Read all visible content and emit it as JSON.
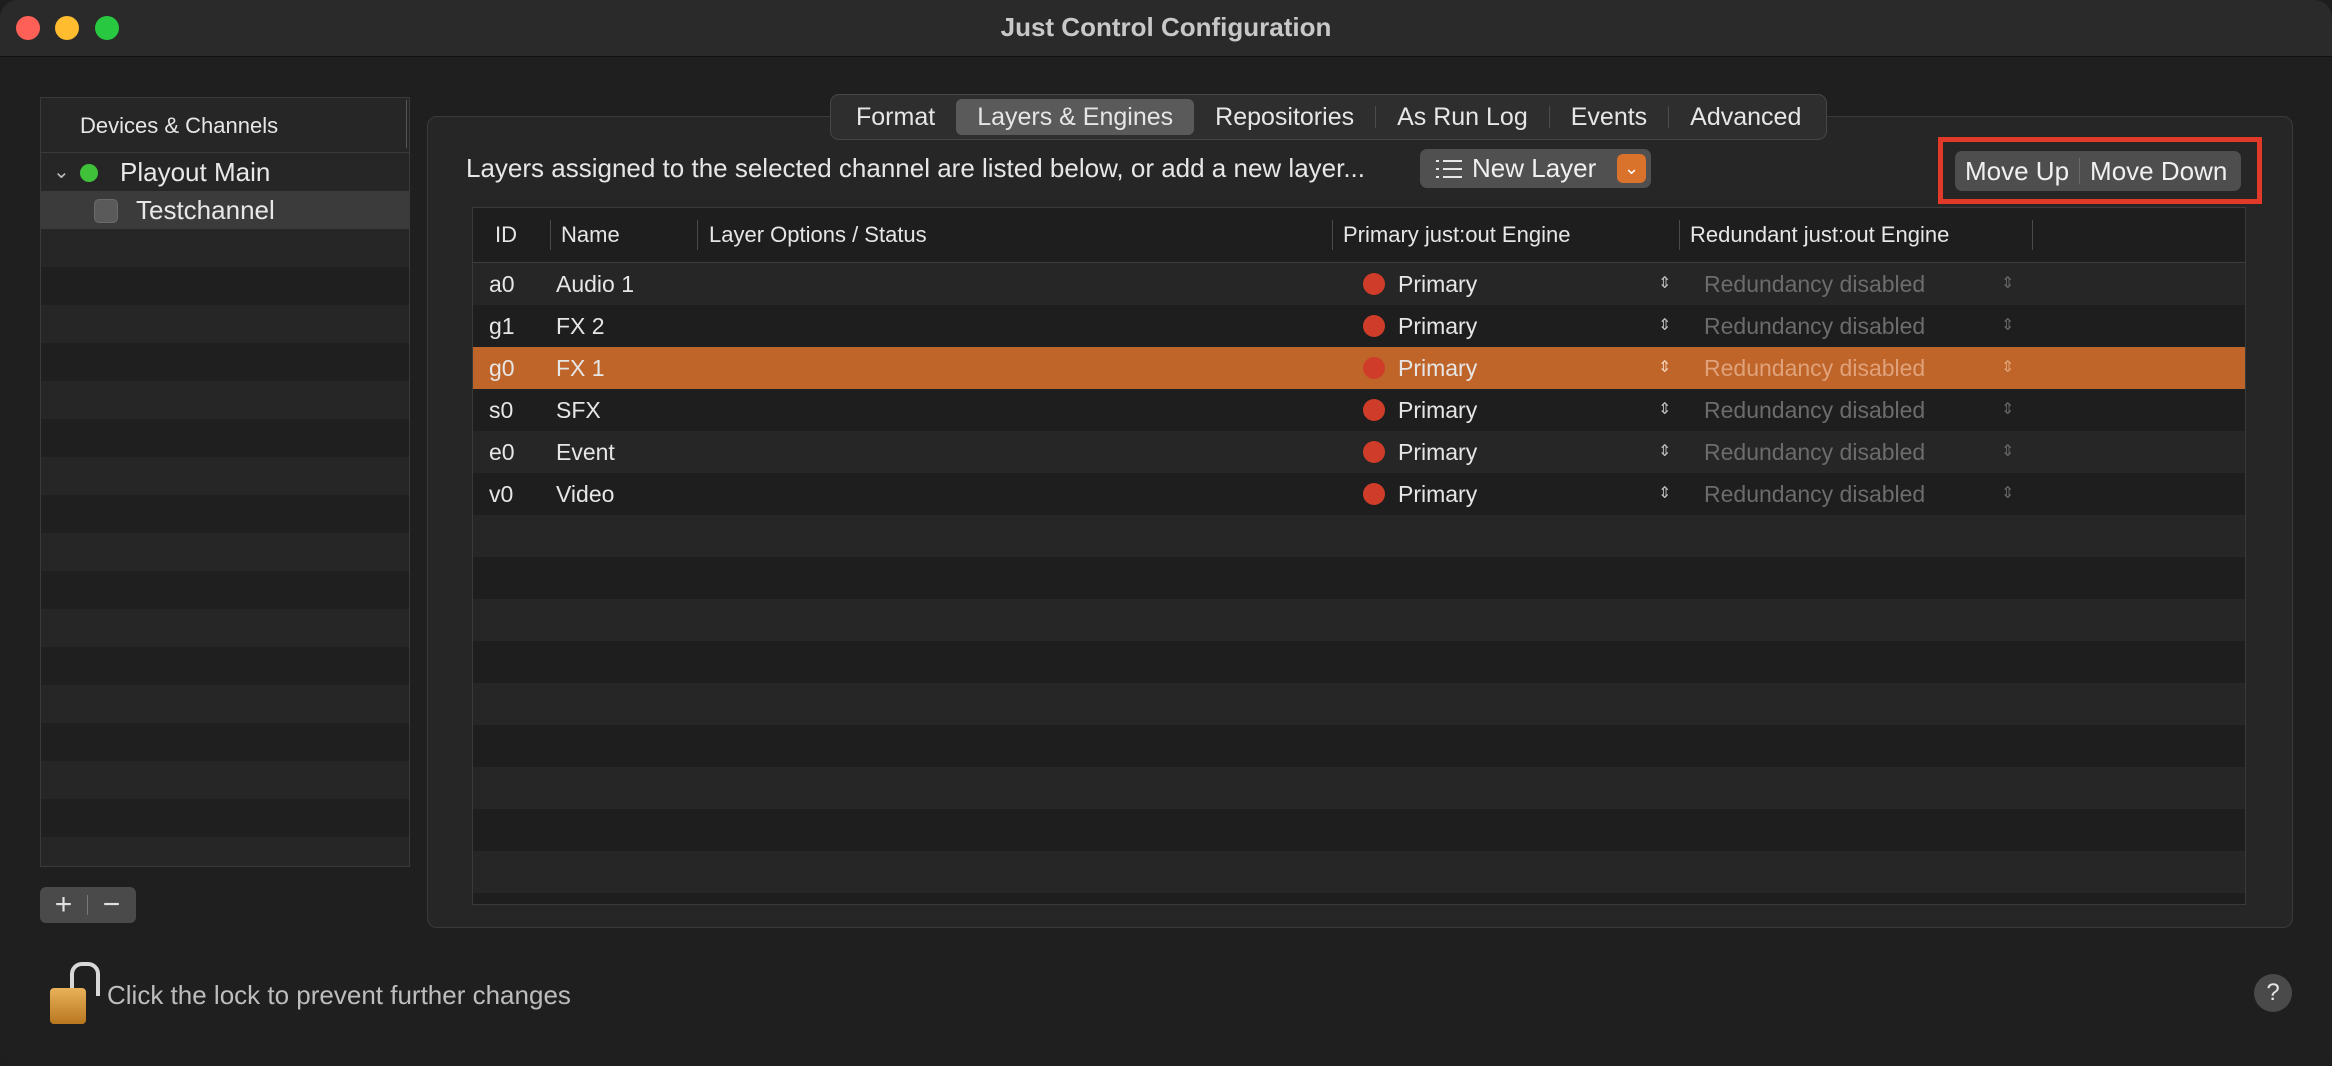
{
  "window": {
    "title": "Just Control Configuration"
  },
  "sidebar": {
    "header": "Devices & Channels",
    "items": [
      {
        "label": "Playout Main",
        "status_color": "#3fc23a"
      },
      {
        "label": "Testchannel",
        "selected": true
      }
    ],
    "add_label": "+",
    "remove_label": "−"
  },
  "tabs": [
    {
      "label": "Format"
    },
    {
      "label": "Layers & Engines",
      "active": true
    },
    {
      "label": "Repositories"
    },
    {
      "label": "As Run Log"
    },
    {
      "label": "Events"
    },
    {
      "label": "Advanced"
    }
  ],
  "toolbar": {
    "info": "Layers assigned to the selected channel are listed below, or add a new layer...",
    "new_layer_label": "New Layer",
    "move_up_label": "Move Up",
    "move_down_label": "Move Down"
  },
  "table": {
    "columns": [
      "ID",
      "Name",
      "Layer Options / Status",
      "Primary just:out Engine",
      "Redundant just:out Engine"
    ],
    "rows": [
      {
        "id": "a0",
        "name": "Audio 1",
        "primary": "Primary",
        "redundant": "Redundancy disabled"
      },
      {
        "id": "g1",
        "name": "FX 2",
        "primary": "Primary",
        "redundant": "Redundancy disabled"
      },
      {
        "id": "g0",
        "name": "FX 1",
        "primary": "Primary",
        "redundant": "Redundancy disabled",
        "selected": true
      },
      {
        "id": "s0",
        "name": "SFX",
        "primary": "Primary",
        "redundant": "Redundancy disabled"
      },
      {
        "id": "e0",
        "name": "Event",
        "primary": "Primary",
        "redundant": "Redundancy disabled"
      },
      {
        "id": "v0",
        "name": "Video",
        "primary": "Primary",
        "redundant": "Redundancy disabled"
      }
    ]
  },
  "footer": {
    "lock_text": "Click the lock to prevent further changes",
    "help_label": "?"
  },
  "colors": {
    "accent": "#c0652a",
    "status_red": "#cf3d2a",
    "highlight_box": "#e23a2a"
  }
}
